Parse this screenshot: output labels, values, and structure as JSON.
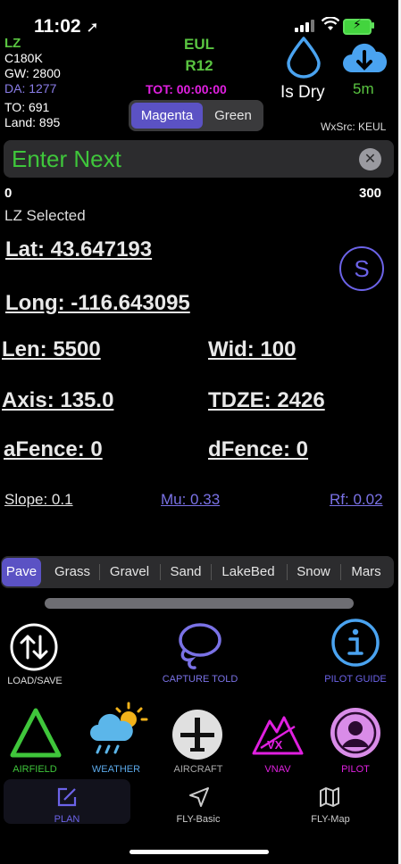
{
  "status": {
    "time": "11:02",
    "location_arrow": "➤"
  },
  "header": {
    "lz_label": "LZ",
    "aircraft_type": "C180K",
    "gw": "GW: 2800",
    "da": "DA: 1277",
    "to": "TO: 691",
    "land": "Land: 895",
    "airport": "EUL",
    "runway": "R12",
    "tot": "TOT: 00:00:00",
    "mode_options": [
      "Magenta",
      "Green"
    ],
    "mode_selected": "Magenta",
    "surface_condition": "Is Dry",
    "wx_time": "5m",
    "wx_source": "WxSrc: KEUL"
  },
  "entry": {
    "placeholder": "Enter Next",
    "clear_icon": "xmark-circle-icon"
  },
  "range": {
    "min": "0",
    "max": "300"
  },
  "selection": {
    "label": "LZ Selected"
  },
  "coords": {
    "lat": "Lat: 43.647193",
    "long": "Long: -116.643095",
    "s_button": "S"
  },
  "runway_data": {
    "len": "Len: 5500",
    "wid": "Wid: 100",
    "axis": "Axis: 135.0",
    "tdze": "TDZE: 2426",
    "afence": "aFence: 0",
    "dfence": "dFence: 0",
    "slope": "Slope: 0.1",
    "mu": "Mu: 0.33",
    "rf": "Rf: 0.02"
  },
  "surfaces": [
    "Pave",
    "Grass",
    "Gravel",
    "Sand",
    "LakeBed",
    "Snow",
    "Mars"
  ],
  "surface_selected": "Pave",
  "tools": {
    "load_save": "LOAD/SAVE",
    "capture_told": "CAPTURE TOLD",
    "pilot_guide": "PILOT GUIDE"
  },
  "modules": {
    "airfield": "AIRFIELD",
    "weather": "WEATHER",
    "aircraft": "AIRCRAFT",
    "vnav": "VNAV",
    "vnav_badge": "VX",
    "pilot": "PILOT"
  },
  "tabs": {
    "plan": "PLAN",
    "fly_basic": "FLY-Basic",
    "fly_map": "FLY-Map"
  },
  "colors": {
    "accent": "#5b52c4",
    "green": "#3fc63b",
    "magenta": "#e020e0",
    "blue": "#5ba8e8"
  }
}
